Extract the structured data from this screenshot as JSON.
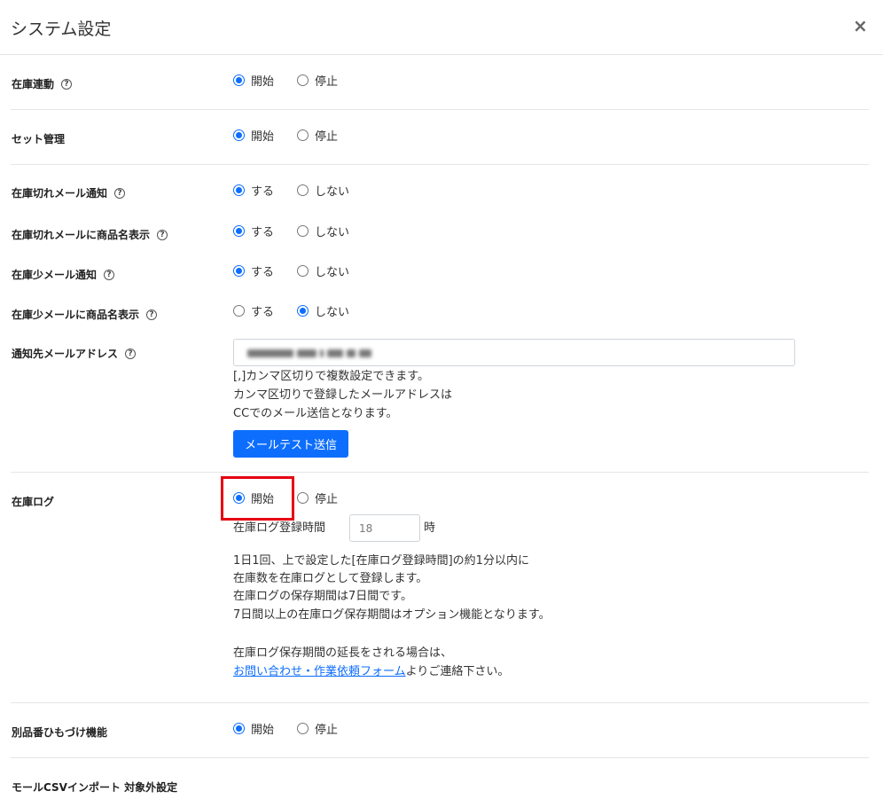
{
  "dialog": {
    "title": "システム設定",
    "close": "×"
  },
  "settings": {
    "inventory_sync": {
      "label": "在庫連動",
      "options": [
        "開始",
        "停止"
      ],
      "selected": 0
    },
    "set_management": {
      "label": "セット管理",
      "options": [
        "開始",
        "停止"
      ],
      "selected": 0
    },
    "out_of_stock_mail": {
      "label": "在庫切れメール通知",
      "options": [
        "する",
        "しない"
      ],
      "selected": 0
    },
    "out_of_stock_product_name": {
      "label": "在庫切れメールに商品名表示",
      "options": [
        "する",
        "しない"
      ],
      "selected": 0
    },
    "low_stock_mail": {
      "label": "在庫少メール通知",
      "options": [
        "する",
        "しない"
      ],
      "selected": 0
    },
    "low_stock_product_name": {
      "label": "在庫少メールに商品名表示",
      "options": [
        "する",
        "しない"
      ],
      "selected": 1
    },
    "notify_email": {
      "label": "通知先メールアドレス",
      "notes": [
        "[,]カンマ区切りで複数設定できます。",
        "カンマ区切りで登録したメールアドレスは",
        "CCでのメール送信となります。"
      ],
      "test_button": "メールテスト送信"
    },
    "inventory_log": {
      "label": "在庫ログ",
      "options": [
        "開始",
        "停止"
      ],
      "selected": 0,
      "time_label": "在庫ログ登録時間",
      "time_value": "18",
      "time_unit": "時",
      "notes": [
        "1日1回、上で設定した[在庫ログ登録時間]の約1分以内に",
        "在庫数を在庫ログとして登録します。",
        "在庫ログの保存期間は7日間です。",
        "7日間以上の在庫ログ保存期間はオプション機能となります。"
      ],
      "extend_note": "在庫ログ保存期間の延長をされる場合は、",
      "link_text": "お問い合わせ・作業依頼フォーム",
      "link_suffix": "よりご連絡下さい。"
    },
    "alt_product_link": {
      "label": "別品番ひもづけ機能",
      "options": [
        "開始",
        "停止"
      ],
      "selected": 0
    },
    "mall_csv_import": {
      "label": "モールCSVインポート 対象外設定"
    }
  },
  "colors": {
    "accent": "#0d6efd",
    "highlight": "#e60012"
  }
}
